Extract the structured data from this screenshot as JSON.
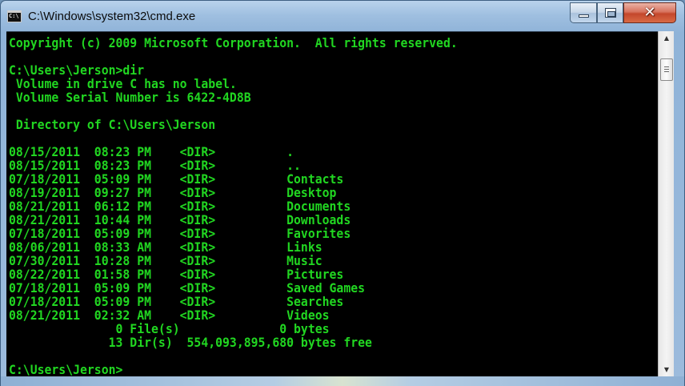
{
  "window": {
    "title": "C:\\Windows\\system32\\cmd.exe",
    "icon": "cmd-icon",
    "controls": {
      "minimize": "minimize-icon",
      "maximize": "maximize-icon",
      "close": "✕"
    }
  },
  "console": {
    "text_color": "#21d621",
    "background": "#000000",
    "lines": [
      "Copyright (c) 2009 Microsoft Corporation.  All rights reserved.",
      "",
      "C:\\Users\\Jerson>dir",
      " Volume in drive C has no label.",
      " Volume Serial Number is 6422-4D8B",
      "",
      " Directory of C:\\Users\\Jerson",
      "",
      "08/15/2011  08:23 PM    <DIR>          .",
      "08/15/2011  08:23 PM    <DIR>          ..",
      "07/18/2011  05:09 PM    <DIR>          Contacts",
      "08/19/2011  09:27 PM    <DIR>          Desktop",
      "08/21/2011  06:12 PM    <DIR>          Documents",
      "08/21/2011  10:44 PM    <DIR>          Downloads",
      "07/18/2011  05:09 PM    <DIR>          Favorites",
      "08/06/2011  08:33 AM    <DIR>          Links",
      "07/30/2011  10:28 PM    <DIR>          Music",
      "08/22/2011  01:58 PM    <DIR>          Pictures",
      "07/18/2011  05:09 PM    <DIR>          Saved Games",
      "07/18/2011  05:09 PM    <DIR>          Searches",
      "08/21/2011  02:32 AM    <DIR>          Videos",
      "               0 File(s)              0 bytes",
      "              13 Dir(s)  554,093,895,680 bytes free",
      "",
      "C:\\Users\\Jerson>"
    ]
  },
  "scrollbar": {
    "up_arrow": "▲",
    "down_arrow": "▼"
  }
}
